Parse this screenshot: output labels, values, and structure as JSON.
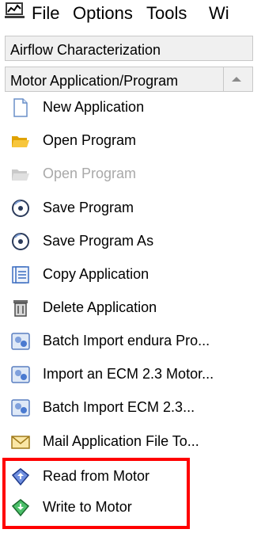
{
  "menubar": {
    "items": [
      "File",
      "Options",
      "Tools",
      "Wi"
    ]
  },
  "panel": {
    "sections": [
      {
        "label": "Airflow Characterization"
      },
      {
        "label": "Motor Application/Program"
      }
    ],
    "items": [
      {
        "label": "New Application",
        "icon": "new-document-icon",
        "enabled": true
      },
      {
        "label": "Open Program",
        "icon": "folder-open-icon",
        "enabled": true
      },
      {
        "label": "Open Program",
        "icon": "folder-open-icon",
        "enabled": false
      },
      {
        "label": "Save Program",
        "icon": "save-disc-icon",
        "enabled": true
      },
      {
        "label": "Save Program As",
        "icon": "save-disc-icon",
        "enabled": true
      },
      {
        "label": "Copy Application",
        "icon": "copy-document-icon",
        "enabled": true
      },
      {
        "label": "Delete Application",
        "icon": "delete-bin-icon",
        "enabled": true
      },
      {
        "label": "Batch Import endura Pro...",
        "icon": "batch-import-icon",
        "enabled": true
      },
      {
        "label": "Import an ECM 2.3 Motor...",
        "icon": "import-icon",
        "enabled": true
      },
      {
        "label": "Batch Import ECM 2.3...",
        "icon": "batch-import-icon",
        "enabled": true
      },
      {
        "label": "Mail Application File To...",
        "icon": "mail-envelope-icon",
        "enabled": true
      },
      {
        "label": "Read from Motor",
        "icon": "read-motor-icon",
        "enabled": true
      },
      {
        "label": "Write to Motor",
        "icon": "write-motor-icon",
        "enabled": true
      }
    ]
  },
  "colors": {
    "highlight": "#ff0000",
    "disabled_text": "#a9a9a9",
    "header_bg": "#f0f0f0",
    "folder": "#f5b800",
    "read_arrow": "#1e4fd0",
    "write_arrow": "#1e9b3c"
  }
}
